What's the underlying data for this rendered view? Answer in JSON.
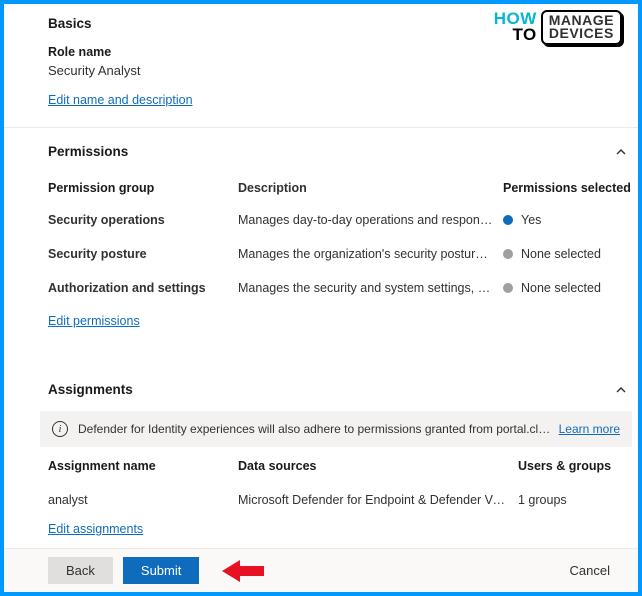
{
  "logo": {
    "how": "HOW",
    "to": "TO",
    "manage": "MANAGE",
    "devices": "DEVICES"
  },
  "basics": {
    "heading": "Basics",
    "roleNameLabel": "Role name",
    "roleNameValue": "Security Analyst",
    "editLink": "Edit name and description"
  },
  "permissions": {
    "heading": "Permissions",
    "colGroup": "Permission group",
    "colDesc": "Description",
    "colSel": "Permissions selected",
    "rows": [
      {
        "name": "Security operations",
        "desc": "Manages day-to-day operations and responds to incident...",
        "sel": "Yes",
        "dot": "blue"
      },
      {
        "name": "Security posture",
        "desc": "Manages the organization's security posture, performs De...",
        "sel": "None selected",
        "dot": "grey"
      },
      {
        "name": "Authorization and settings",
        "desc": "Manages the security and system settings, creates and ass...",
        "sel": "None selected",
        "dot": "grey"
      }
    ],
    "editLink": "Edit permissions"
  },
  "assignments": {
    "heading": "Assignments",
    "banner": {
      "msg": "Defender for Identity experiences will also adhere to permissions granted from portal.cloudapsecurity.com.",
      "learn": "Learn more"
    },
    "colName": "Assignment name",
    "colDs": "Data sources",
    "colUg": "Users & groups",
    "rows": [
      {
        "name": "analyst",
        "ds": "Microsoft Defender for Endpoint & Defender Vulnerability...",
        "ug": "1 groups"
      }
    ],
    "editLink": "Edit assignments"
  },
  "footer": {
    "back": "Back",
    "submit": "Submit",
    "cancel": "Cancel"
  }
}
